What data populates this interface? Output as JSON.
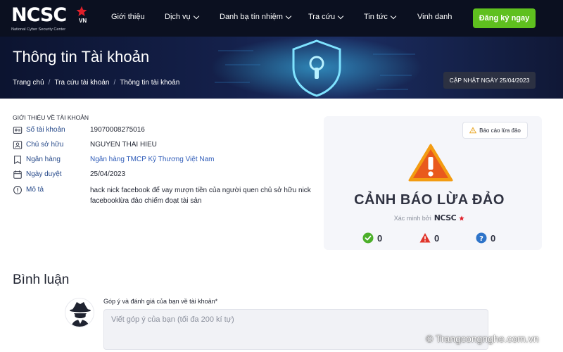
{
  "brand": {
    "logo_text": "NCSC",
    "logo_suffix": "VN",
    "logo_subtitle": "National Cyber Security Center"
  },
  "nav": {
    "items": [
      {
        "label": "Giới thiệu",
        "has_dropdown": false
      },
      {
        "label": "Dịch vụ",
        "has_dropdown": true
      },
      {
        "label": "Danh bạ tín nhiệm",
        "has_dropdown": true
      },
      {
        "label": "Tra cứu",
        "has_dropdown": true
      },
      {
        "label": "Tin tức",
        "has_dropdown": true
      },
      {
        "label": "Vinh danh",
        "has_dropdown": false
      }
    ],
    "signup_label": "Đăng ký ngay"
  },
  "hero": {
    "title": "Thông tin Tài khoản",
    "breadcrumb": [
      "Trang chủ",
      "Tra cứu tài khoản",
      "Thông tin tài khoản"
    ],
    "updated_badge": "CẬP NHẬT NGÀY 25/04/2023"
  },
  "account": {
    "section_title": "Giới thiệu về tài khoản",
    "fields": [
      {
        "icon": "id-card-icon",
        "label": "Số tài khoản",
        "value": "19070008275016"
      },
      {
        "icon": "user-icon",
        "label": "Chủ sở hữu",
        "value": "NGUYEN THAI HIEU"
      },
      {
        "icon": "bank-icon",
        "label": "Ngân hàng",
        "value": "Ngân hàng TMCP Kỹ Thương Việt Nam"
      },
      {
        "icon": "calendar-icon",
        "label": "Ngày duyệt",
        "value": "25/04/2023"
      },
      {
        "icon": "info-icon",
        "label": "Mô tả",
        "value": "hack nick facebook để vay mượn tiền của người quen chủ sở hữu nick facebooklừa đảo chiếm đoạt tài sản"
      }
    ]
  },
  "warning": {
    "report_label": "Báo cáo lừa đảo",
    "title": "CẢNH BÁO LỪA ĐẢO",
    "verified_by": "Xác minh bởi",
    "verified_logo": "NCSC",
    "stats": [
      {
        "icon": "check-circle-icon",
        "color": "#4caf2a",
        "value": "0"
      },
      {
        "icon": "alert-triangle-icon",
        "color": "#e0352b",
        "value": "0"
      },
      {
        "icon": "question-circle-icon",
        "color": "#2e74c9",
        "value": "0"
      }
    ]
  },
  "comments": {
    "title": "Bình luận",
    "field_label": "Góp ý và đánh giá của bạn về tài khoản*",
    "placeholder": "Viết góp ý của bạn (tối đa 200 kí tự)"
  },
  "watermark": "© Trangcongnghe.com.vn",
  "colors": {
    "nav_bg": "#0b1020",
    "accent_green": "#5fc01f",
    "warning_red": "#e0352b",
    "warning_orange": "#f39c12",
    "link_blue": "#2e5bb8"
  }
}
